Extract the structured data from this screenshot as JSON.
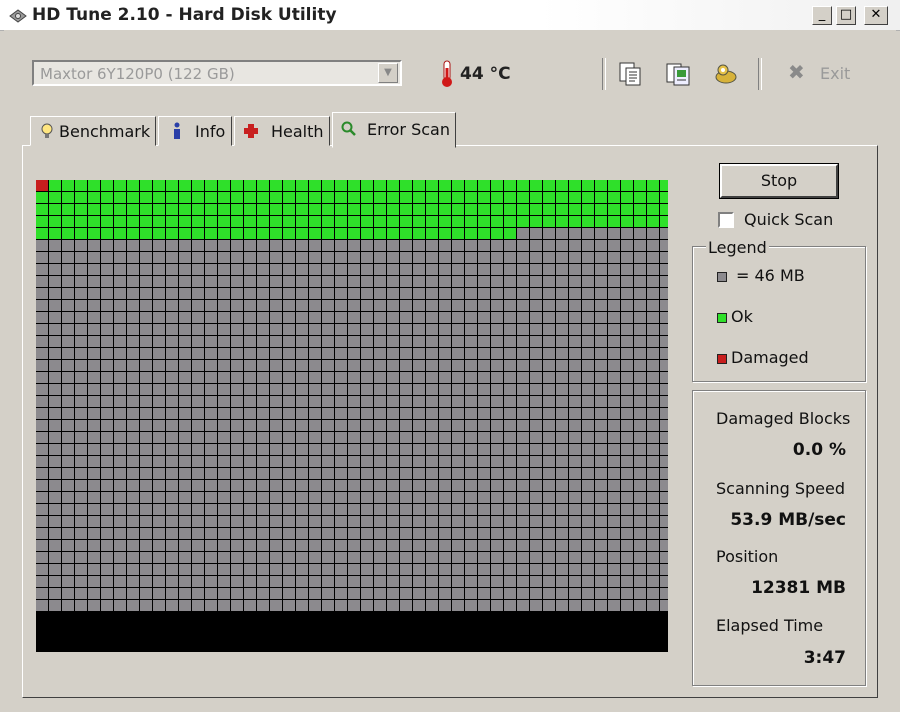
{
  "window": {
    "title": "HD Tune 2.10 - Hard Disk Utility"
  },
  "toolbar": {
    "drive": "Maxtor 6Y120P0 (122 GB)",
    "temperature": "44 °C",
    "exit_label": "Exit"
  },
  "tabs": [
    {
      "label": "Benchmark",
      "icon": "benchmark-icon"
    },
    {
      "label": "Info",
      "icon": "info-icon"
    },
    {
      "label": "Health",
      "icon": "health-icon"
    },
    {
      "label": "Error Scan",
      "icon": "error-scan-icon",
      "active": true
    }
  ],
  "scan": {
    "stop_label": "Stop",
    "quick_scan_label": "Quick Scan",
    "quick_scan_checked": false,
    "block_grid": {
      "columns": 49,
      "rows": 36,
      "scanned_blocks": 233,
      "damaged_block_index": 0
    }
  },
  "legend": {
    "title": "Legend",
    "block_size": "= 46 MB",
    "ok": "Ok",
    "damaged": "Damaged",
    "colors": {
      "block": "#8c8a8e",
      "ok": "#2fe02a",
      "damaged": "#c81e1e"
    }
  },
  "stats": {
    "damaged_blocks_label": "Damaged Blocks",
    "damaged_blocks_value": "0.0 %",
    "scanning_speed_label": "Scanning Speed",
    "scanning_speed_value": "53.9 MB/sec",
    "position_label": "Position",
    "position_value": "12381 MB",
    "elapsed_time_label": "Elapsed Time",
    "elapsed_time_value": "3:47"
  }
}
